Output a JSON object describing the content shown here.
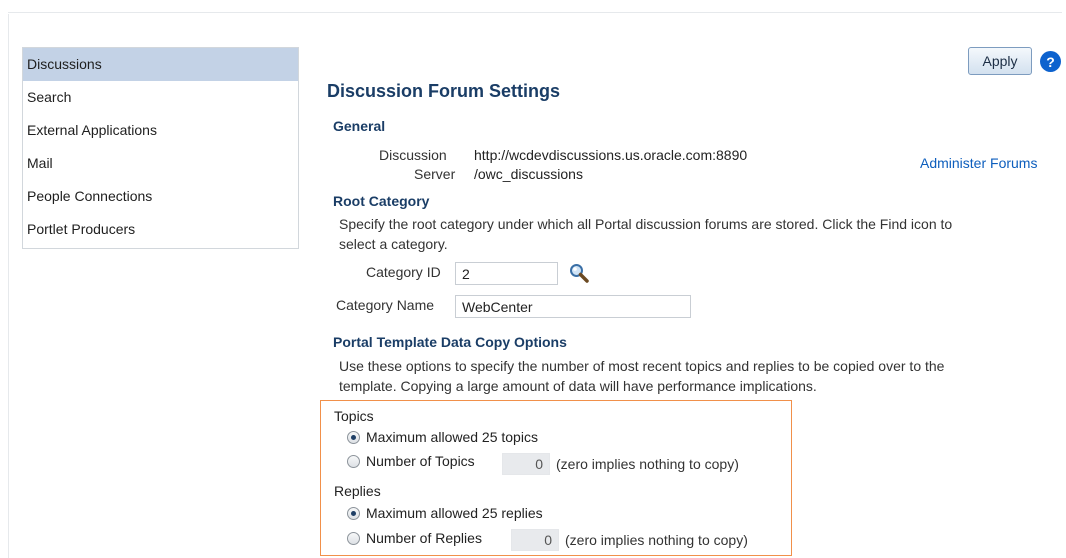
{
  "sidebar": {
    "items": [
      {
        "label": "Discussions"
      },
      {
        "label": "Search"
      },
      {
        "label": "External Applications"
      },
      {
        "label": "Mail"
      },
      {
        "label": "People Connections"
      },
      {
        "label": "Portlet Producers"
      }
    ]
  },
  "toolbar": {
    "apply_label": "Apply",
    "help_glyph": "?"
  },
  "page_title": "Discussion Forum Settings",
  "general": {
    "heading": "General",
    "server_label_1": "Discussion",
    "server_label_2": "Server",
    "server_url_1": "http://wcdevdiscussions.us.oracle.com:8890",
    "server_url_2": "/owc_discussions",
    "admin_link": "Administer Forums"
  },
  "root_category": {
    "heading": "Root Category",
    "description_1": "Specify the root category under which all Portal discussion forums are stored. Click the Find icon to",
    "description_2": "select a category.",
    "category_id_label": "Category ID",
    "category_id_value": "2",
    "category_name_label": "Category Name",
    "category_name_value": "WebCenter"
  },
  "copy_options": {
    "heading": "Portal Template Data Copy Options",
    "description_1": "Use these options to specify the number of most recent topics and replies to be copied over to the",
    "description_2": "template. Copying a large amount of data will have performance implications.",
    "topics": {
      "label": "Topics",
      "max_option": "Maximum allowed 25 topics",
      "number_option": "Number of Topics",
      "number_value": "0",
      "hint": "(zero implies nothing to copy)"
    },
    "replies": {
      "label": "Replies",
      "max_option": "Maximum allowed 25 replies",
      "number_option": "Number of Replies",
      "number_value": "0",
      "hint": "(zero implies nothing to copy)"
    }
  },
  "colors": {
    "selected_nav": "#c3d2e6",
    "heading": "#1a3d66",
    "link": "#0d5ebd",
    "highlight_border": "#f1904a",
    "help_icon": "#0d62ce"
  }
}
